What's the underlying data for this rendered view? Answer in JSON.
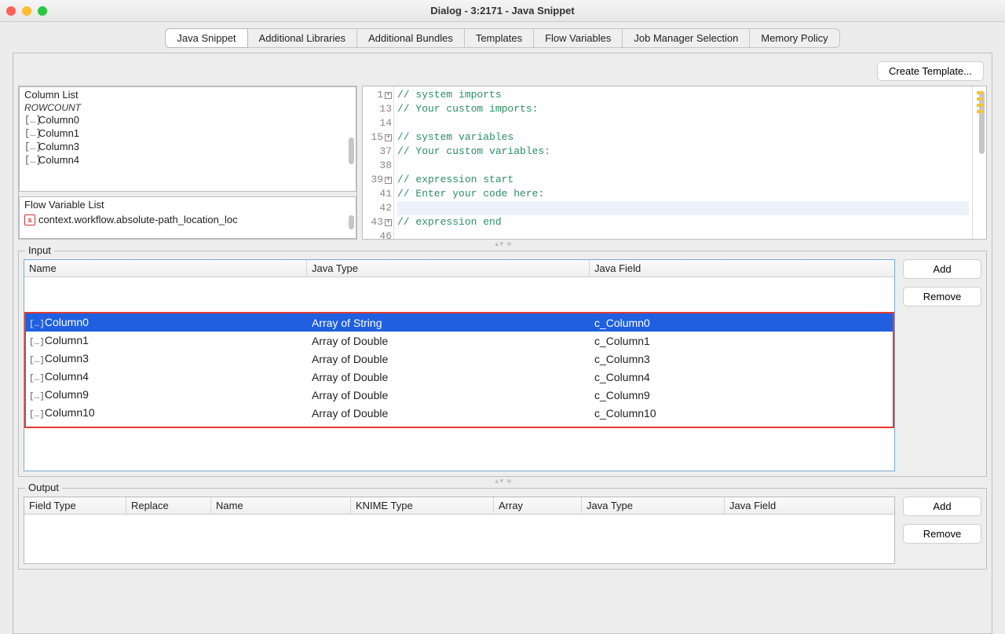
{
  "title": "Dialog - 3:2171 - Java Snippet",
  "tabs": [
    "Java Snippet",
    "Additional Libraries",
    "Additional Bundles",
    "Templates",
    "Flow Variables",
    "Job Manager Selection",
    "Memory Policy"
  ],
  "active_tab": 0,
  "buttons": {
    "create_template": "Create Template...",
    "add": "Add",
    "remove": "Remove"
  },
  "column_list": {
    "title": "Column List",
    "rowcount_label": "ROWCOUNT",
    "items": [
      "Column0",
      "Column1",
      "Column3",
      "Column4"
    ]
  },
  "flow_variable_list": {
    "title": "Flow Variable List",
    "items": [
      "context.workflow.absolute-path_location_loc"
    ]
  },
  "code": {
    "lines": [
      {
        "num": "1",
        "fold": true,
        "text": "// system imports",
        "cls": "cm-comment"
      },
      {
        "num": "13",
        "fold": false,
        "text": "// Your custom imports:",
        "cls": "cm-comment"
      },
      {
        "num": "14",
        "fold": false,
        "text": "",
        "cls": ""
      },
      {
        "num": "15",
        "fold": true,
        "text": "// system variables",
        "cls": "cm-comment"
      },
      {
        "num": "37",
        "fold": false,
        "text": "// Your custom variables:",
        "cls": "cm-comment"
      },
      {
        "num": "38",
        "fold": false,
        "text": "",
        "cls": ""
      },
      {
        "num": "39",
        "fold": true,
        "text": "// expression start",
        "cls": "cm-comment"
      },
      {
        "num": "41",
        "fold": false,
        "text": "// Enter your code here:",
        "cls": "cm-comment"
      },
      {
        "num": "42",
        "fold": false,
        "text": "",
        "cls": "",
        "hilite": true
      },
      {
        "num": "43",
        "fold": true,
        "text": "// expression end",
        "cls": "cm-comment"
      },
      {
        "num": "46",
        "fold": false,
        "text": "",
        "cls": ""
      }
    ]
  },
  "input": {
    "legend": "Input",
    "headers": [
      "Name",
      "Java Type",
      "Java Field"
    ],
    "rows": [
      {
        "name": "Column0",
        "type": "Array of String",
        "field": "c_Column0",
        "selected": true
      },
      {
        "name": "Column1",
        "type": "Array of Double",
        "field": "c_Column1"
      },
      {
        "name": "Column3",
        "type": "Array of Double",
        "field": "c_Column3"
      },
      {
        "name": "Column4",
        "type": "Array of Double",
        "field": "c_Column4"
      },
      {
        "name": "Column9",
        "type": "Array of Double",
        "field": "c_Column9"
      },
      {
        "name": "Column10",
        "type": "Array of Double",
        "field": "c_Column10"
      }
    ]
  },
  "output": {
    "legend": "Output",
    "headers": [
      "Field Type",
      "Replace",
      "Name",
      "KNIME Type",
      "Array",
      "Java Type",
      "Java Field"
    ]
  }
}
